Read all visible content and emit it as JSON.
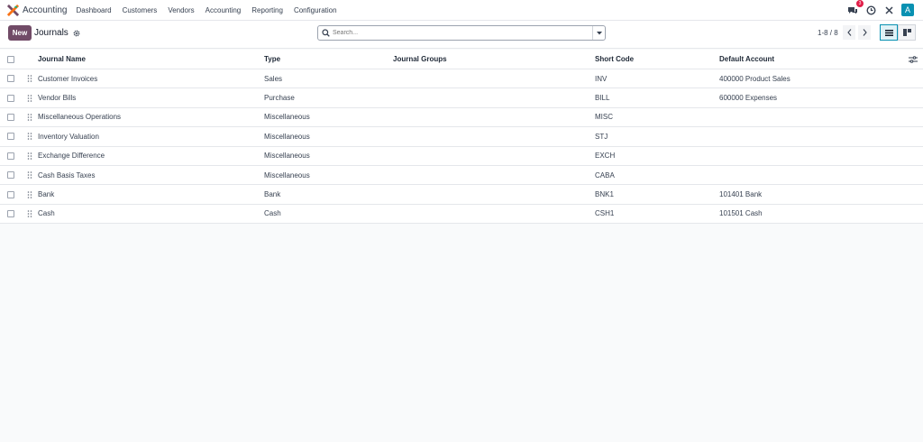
{
  "nav": {
    "app_name": "Accounting",
    "menu": [
      "Dashboard",
      "Customers",
      "Vendors",
      "Accounting",
      "Reporting",
      "Configuration"
    ],
    "chat_badge": "3",
    "avatar_letter": "A"
  },
  "control": {
    "new_label": "New",
    "title": "Journals",
    "search_placeholder": "Search...",
    "pager": "1-8 / 8"
  },
  "columns": [
    "Journal Name",
    "Type",
    "Journal Groups",
    "Short Code",
    "Default Account"
  ],
  "rows": [
    {
      "name": "Customer Invoices",
      "type": "Sales",
      "group": "",
      "code": "INV",
      "account": "400000 Product Sales"
    },
    {
      "name": "Vendor Bills",
      "type": "Purchase",
      "group": "",
      "code": "BILL",
      "account": "600000 Expenses"
    },
    {
      "name": "Miscellaneous Operations",
      "type": "Miscellaneous",
      "group": "",
      "code": "MISC",
      "account": ""
    },
    {
      "name": "Inventory Valuation",
      "type": "Miscellaneous",
      "group": "",
      "code": "STJ",
      "account": ""
    },
    {
      "name": "Exchange Difference",
      "type": "Miscellaneous",
      "group": "",
      "code": "EXCH",
      "account": ""
    },
    {
      "name": "Cash Basis Taxes",
      "type": "Miscellaneous",
      "group": "",
      "code": "CABA",
      "account": ""
    },
    {
      "name": "Bank",
      "type": "Bank",
      "group": "",
      "code": "BNK1",
      "account": "101401 Bank"
    },
    {
      "name": "Cash",
      "type": "Cash",
      "group": "",
      "code": "CSH1",
      "account": "101501 Cash"
    }
  ],
  "colors": {
    "brand": "#714b67",
    "avatar": "#0891b2",
    "badge": "#e11d48"
  }
}
